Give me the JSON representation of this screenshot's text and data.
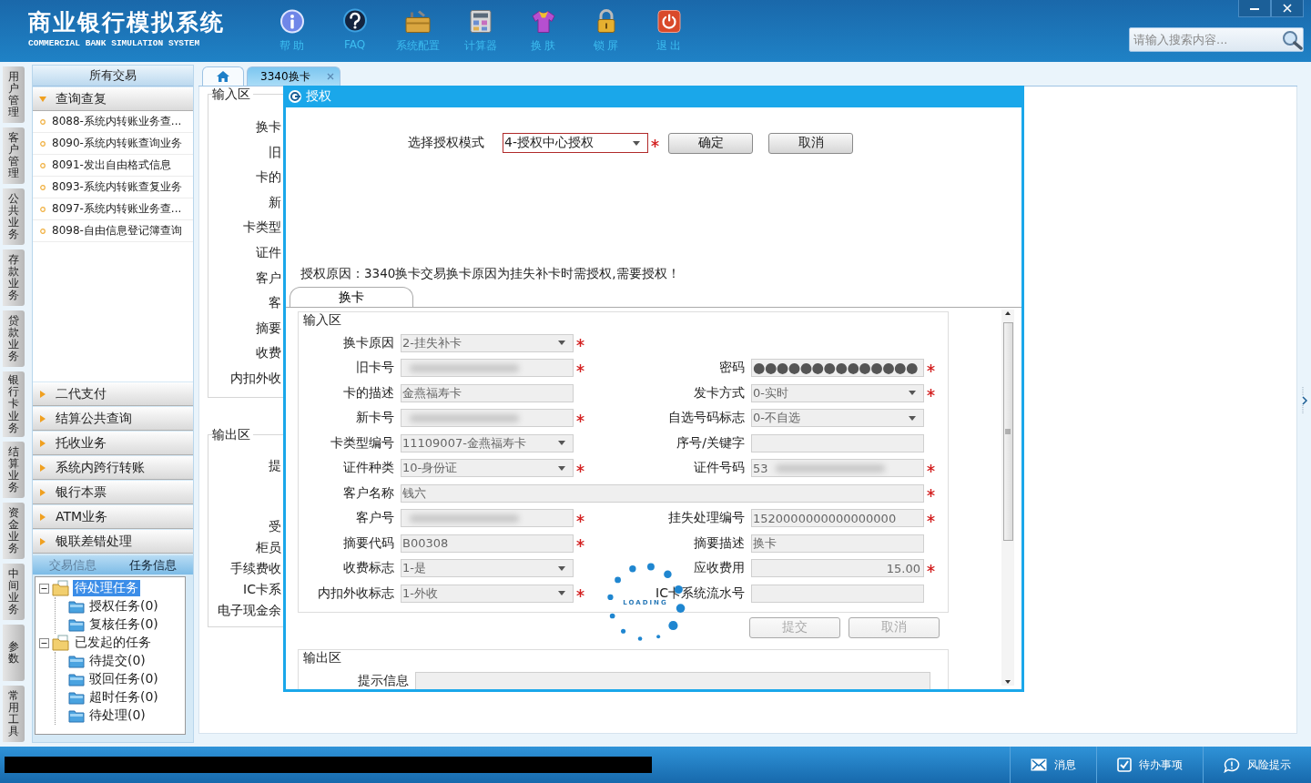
{
  "app": {
    "title": "商业银行模拟系统",
    "subtitle": "COMMERCIAL BANK SIMULATION SYSTEM"
  },
  "toolbar": [
    {
      "kind": "info",
      "label": "帮 助"
    },
    {
      "kind": "faq",
      "label": "FAQ"
    },
    {
      "kind": "toolbox",
      "label": "系统配置"
    },
    {
      "kind": "calculator",
      "label": "计算器"
    },
    {
      "kind": "shirt",
      "label": "换 肤"
    },
    {
      "kind": "lock",
      "label": "锁 屏"
    },
    {
      "kind": "power",
      "label": "退 出"
    }
  ],
  "search": {
    "placeholder": "请输入搜索内容..."
  },
  "module_tabs": [
    "用户管理",
    "客户管理",
    "公共业务",
    "存款业务",
    "贷款业务",
    "银行卡业务",
    "结算业务",
    "资金业务",
    "中间业务",
    "参数",
    "常用工具"
  ],
  "sidebar": {
    "title": "所有交易",
    "groups": [
      {
        "label": "查询查复",
        "expanded": true,
        "items": [
          "8088-系统内转账业务查...",
          "8090-系统内转账查询业务",
          "8091-发出自由格式信息",
          "8093-系统内转账查复业务",
          "8097-系统内转账业务查...",
          "8098-自由信息登记簿查询"
        ]
      },
      {
        "label": "二代支付",
        "expanded": false
      },
      {
        "label": "结算公共查询",
        "expanded": false
      },
      {
        "label": "托收业务",
        "expanded": false
      },
      {
        "label": "系统内跨行转账",
        "expanded": false
      },
      {
        "label": "银行本票",
        "expanded": false
      },
      {
        "label": "ATM业务",
        "expanded": false
      },
      {
        "label": "银联差错处理",
        "expanded": false
      }
    ],
    "info_tabs": [
      {
        "label": "交易信息",
        "selected": false
      },
      {
        "label": "任务信息",
        "selected": true
      }
    ],
    "tree": [
      {
        "label": "待处理任务",
        "expanded": true,
        "selected": true,
        "children": [
          {
            "label": "授权任务(0)",
            "selected": false
          },
          {
            "label": "复核任务(0)",
            "selected": false
          }
        ]
      },
      {
        "label": "已发起的任务",
        "expanded": true,
        "selected": false,
        "children": [
          {
            "label": "待提交(0)",
            "selected": false
          },
          {
            "label": "驳回任务(0)",
            "selected": false
          },
          {
            "label": "超时任务(0)",
            "selected": false
          },
          {
            "label": "待处理(0)",
            "selected": false
          }
        ]
      }
    ]
  },
  "content_tabs": [
    {
      "kind": "home",
      "selected": false
    },
    {
      "kind": "page",
      "label": "3340换卡",
      "selected": true
    }
  ],
  "background_form": {
    "input_legend": "输入区",
    "input_labels": [
      "换卡",
      "旧",
      "卡的",
      "新",
      "卡类型",
      "证件",
      "客户",
      "客",
      "摘要",
      "收费",
      "内扣外收"
    ],
    "output_legend": "输出区",
    "output_label_groups": [
      [
        "提"
      ],
      [
        "受",
        "柜员",
        "手续费收",
        "IC卡系",
        "电子现金余"
      ]
    ]
  },
  "dialog": {
    "title": "授权",
    "mode_label": "选择授权模式",
    "mode_value": "4-授权中心授权",
    "mode_required": true,
    "buttons": [
      "确定",
      "取消"
    ],
    "reason": "授权原因：3340换卡交易换卡原因为挂失补卡时需授权,需要授权！",
    "tabs": [
      {
        "label": "换卡",
        "selected": true
      }
    ],
    "input_legend": "输入区",
    "rows": [
      [
        {
          "label": "换卡原因",
          "kind": "select",
          "value": "2-挂失补卡",
          "required": true
        }
      ],
      [
        {
          "label": "旧卡号",
          "kind": "text",
          "blurred": true,
          "required": true
        },
        {
          "label": "密码",
          "kind": "password",
          "value": "●●●●●●●●●●●●●●",
          "required": true
        }
      ],
      [
        {
          "label": "卡的描述",
          "kind": "text",
          "value": "金燕福寿卡"
        },
        {
          "label": "发卡方式",
          "kind": "select",
          "value": "0-实时",
          "required": true
        }
      ],
      [
        {
          "label": "新卡号",
          "kind": "text",
          "blurred": true,
          "required": true
        },
        {
          "label": "自选号码标志",
          "kind": "select",
          "value": "0-不自选"
        }
      ],
      [
        {
          "label": "卡类型编号",
          "kind": "select",
          "value": "11109007-金燕福寿卡"
        },
        {
          "label": "序号/关键字",
          "kind": "text"
        }
      ],
      [
        {
          "label": "证件种类",
          "kind": "select",
          "value": "10-身份证",
          "required": true
        },
        {
          "label": "证件号码",
          "kind": "text",
          "value": "53",
          "blurred": true,
          "required": true
        }
      ],
      [
        {
          "label": "客户名称",
          "kind": "text",
          "value": "钱六",
          "wide": true,
          "required": true
        }
      ],
      [
        {
          "label": "客户号",
          "kind": "text",
          "blurred": true,
          "required": true
        },
        {
          "label": "挂失处理编号",
          "kind": "text",
          "value": "1520000000000000000",
          "required": true
        }
      ],
      [
        {
          "label": "摘要代码",
          "kind": "text",
          "value": "B00308",
          "required": true
        },
        {
          "label": "摘要描述",
          "kind": "text",
          "value": "换卡"
        }
      ],
      [
        {
          "label": "收费标志",
          "kind": "select",
          "value": "1-是"
        },
        {
          "label": "应收费用",
          "kind": "amount",
          "value": "15.00",
          "required": true
        }
      ],
      [
        {
          "label": "内扣外收标志",
          "kind": "select",
          "value": "1-外收",
          "required": true
        },
        {
          "label": "IC卡系统流水号",
          "kind": "text"
        }
      ]
    ],
    "actions": [
      {
        "label": "提交",
        "disabled": true
      },
      {
        "label": "取消",
        "disabled": true
      }
    ],
    "output_legend": "输出区",
    "output_fields": [
      {
        "label": "提示信息",
        "kind": "text"
      }
    ],
    "loading": "LOADING"
  },
  "status_bar": [
    {
      "kind": "message",
      "label": "消息"
    },
    {
      "kind": "todo",
      "label": "待办事项"
    },
    {
      "kind": "risk",
      "label": "风险提示"
    }
  ]
}
